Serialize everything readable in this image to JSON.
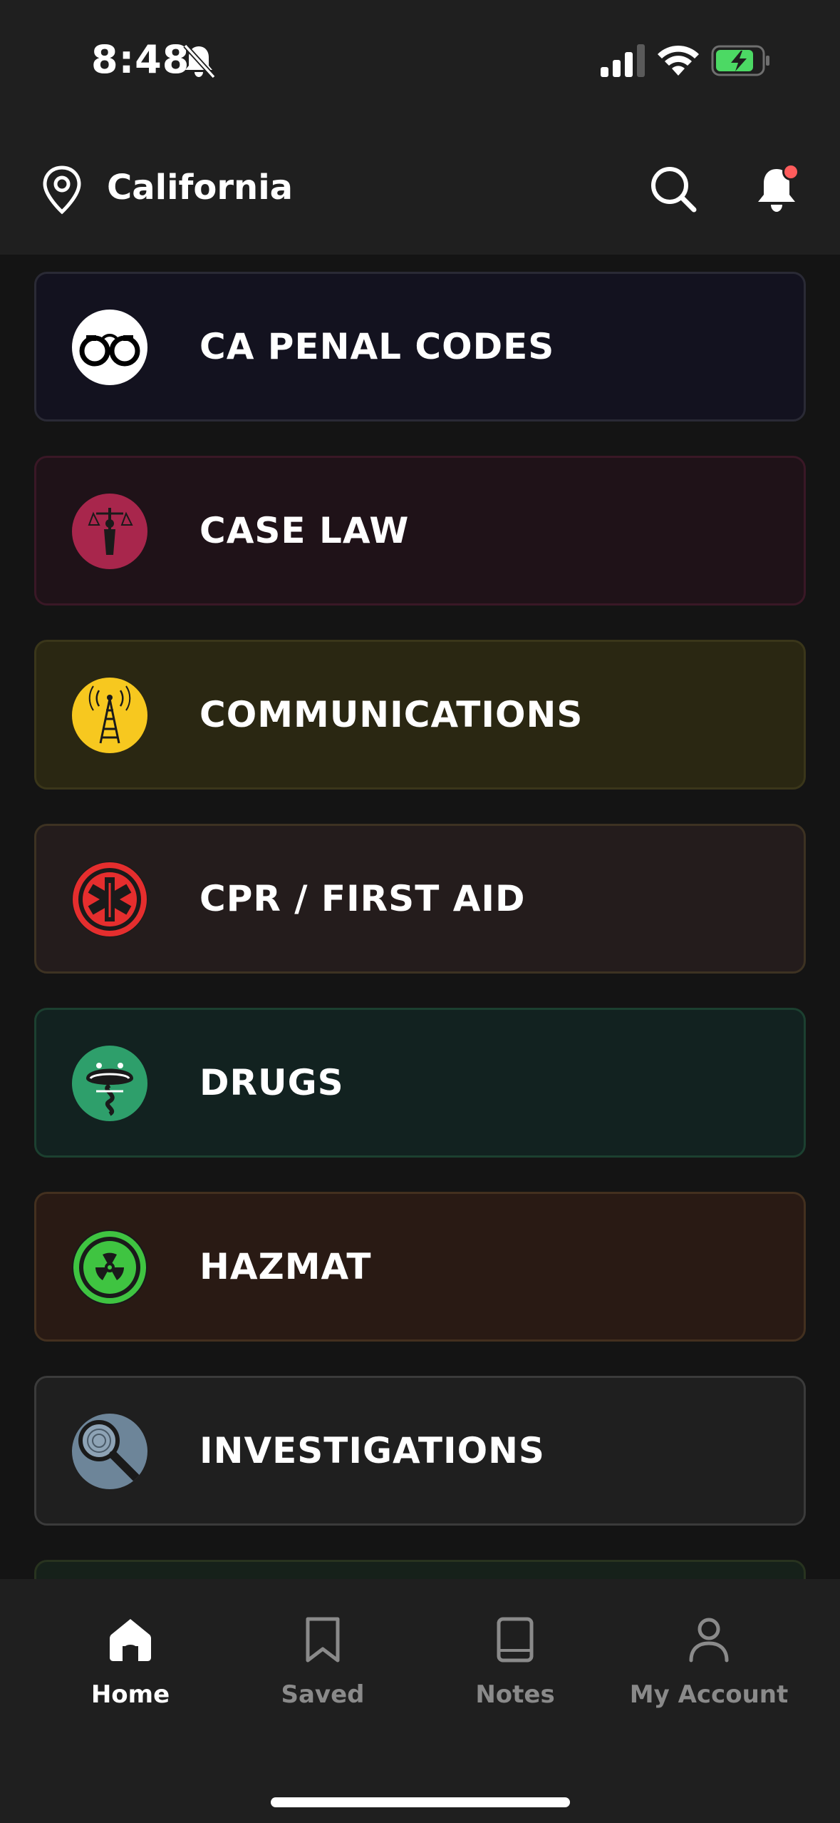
{
  "status_bar": {
    "time": "8:48",
    "icons": [
      "bell-slash-icon",
      "cellular-signal-icon",
      "wifi-icon",
      "battery-charging-icon"
    ],
    "battery_color": "#4cd964"
  },
  "header": {
    "location": "California",
    "icons": [
      "location-pin-icon",
      "search-icon",
      "notification-bell-icon"
    ],
    "notification_dot_color": "#ff5c5c"
  },
  "categories": [
    {
      "label": "CA PENAL CODES",
      "icon": "handcuffs-icon",
      "bg": "#13121f",
      "border": "#2a2a35",
      "badge": "#ffffff"
    },
    {
      "label": "CASE LAW",
      "icon": "justice-scales-icon",
      "bg": "#1f1218",
      "border": "#3a1826",
      "badge": "#a8264c"
    },
    {
      "label": "COMMUNICATIONS",
      "icon": "radio-tower-icon",
      "bg": "#2a2712",
      "border": "#3a361a",
      "badge": "#f7c81f"
    },
    {
      "label": "CPR / FIRST AID",
      "icon": "star-of-life-icon",
      "bg": "#241c1c",
      "border": "#3d3222",
      "badge": "#e52e2e"
    },
    {
      "label": "DRUGS",
      "icon": "snake-bowl-icon",
      "bg": "#122220",
      "border": "#1c4030",
      "badge": "#2e9f6b"
    },
    {
      "label": "HAZMAT",
      "icon": "radiation-icon",
      "bg": "#291a14",
      "border": "#43301f",
      "badge": "#3fc441"
    },
    {
      "label": "INVESTIGATIONS",
      "icon": "magnifying-glass-icon",
      "bg": "#1f1f1f",
      "border": "#3b3b3b",
      "badge": "#6d8599"
    },
    {
      "label": "",
      "icon": "",
      "bg": "#16211a",
      "border": "#28331f",
      "badge": "#2e7d32"
    }
  ],
  "bottom_nav": [
    {
      "label": "Home",
      "icon": "home-icon",
      "active": true
    },
    {
      "label": "Saved",
      "icon": "bookmark-icon",
      "active": false
    },
    {
      "label": "Notes",
      "icon": "book-icon",
      "active": false
    },
    {
      "label": "My Account",
      "icon": "user-icon",
      "active": false
    }
  ],
  "colors": {
    "active_nav": "#ffffff",
    "inactive_nav": "#8a8a8a"
  }
}
